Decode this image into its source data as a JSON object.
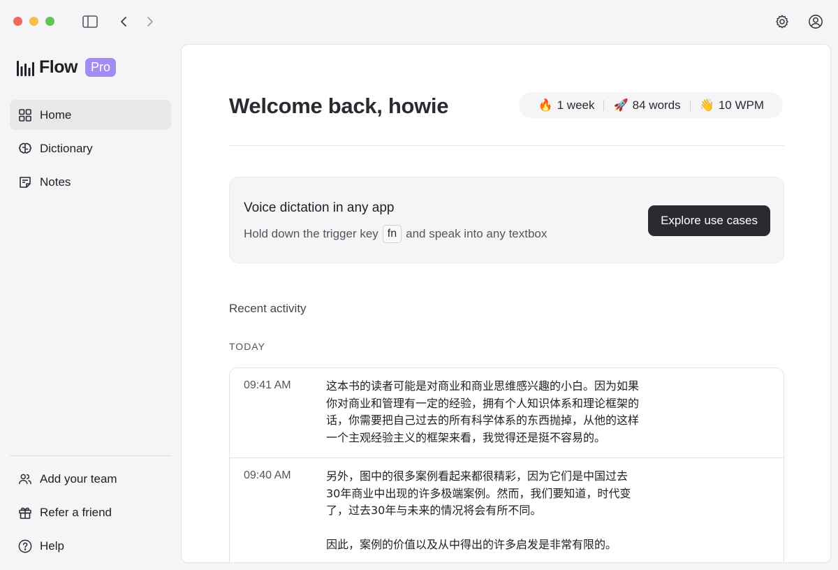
{
  "app": {
    "name": "Flow",
    "plan_badge": "Pro"
  },
  "sidebar": {
    "items": [
      {
        "label": "Home",
        "icon": "grid-icon",
        "active": true
      },
      {
        "label": "Dictionary",
        "icon": "brain-icon",
        "active": false
      },
      {
        "label": "Notes",
        "icon": "note-icon",
        "active": false
      }
    ],
    "bottom_items": [
      {
        "label": "Add your team",
        "icon": "team-icon"
      },
      {
        "label": "Refer a friend",
        "icon": "gift-icon"
      },
      {
        "label": "Help",
        "icon": "help-icon"
      }
    ]
  },
  "header": {
    "welcome": "Welcome back, howie",
    "stats": [
      {
        "emoji": "🔥",
        "label": "1 week"
      },
      {
        "emoji": "🚀",
        "label": "84 words"
      },
      {
        "emoji": "👋",
        "label": "10 WPM"
      }
    ]
  },
  "promo": {
    "title": "Voice dictation in any app",
    "sub_before": "Hold down the trigger key",
    "key": "fn",
    "sub_after": "and speak into any textbox",
    "button": "Explore use cases"
  },
  "activity": {
    "section_title": "Recent activity",
    "group_label": "TODAY",
    "entries": [
      {
        "time": "09:41 AM",
        "paragraphs": [
          "这本书的读者可能是对商业和商业思维感兴趣的小白。因为如果你对商业和管理有一定的经验，拥有个人知识体系和理论框架的话，你需要把自己过去的所有科学体系的东西抛掉，从他的这样一个主观经验主义的框架来看，我觉得还是挺不容易的。"
        ]
      },
      {
        "time": "09:40 AM",
        "paragraphs": [
          "另外，图中的很多案例看起来都很精彩，因为它们是中国过去30年商业中出现的许多极端案例。然而，我们要知道，时代变了，过去30年与未来的情况将会有所不同。",
          "因此，案例的价值以及从中得出的许多启发是非常有限的。"
        ]
      }
    ]
  },
  "colors": {
    "accent": "#a48bf4",
    "button_bg": "#2b2a31",
    "active_nav_bg": "#e8e8ea"
  }
}
